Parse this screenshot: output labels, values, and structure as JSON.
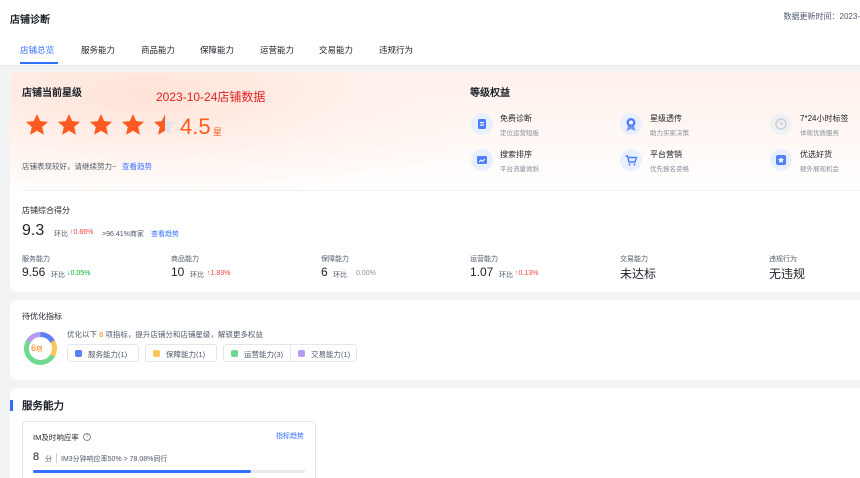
{
  "header": {
    "title": "店铺诊断",
    "update_label": "数据更新时间：2023-"
  },
  "tabs": [
    {
      "label": "店铺总览",
      "active": true
    },
    {
      "label": "服务能力",
      "active": false
    },
    {
      "label": "商品能力",
      "active": false
    },
    {
      "label": "保障能力",
      "active": false
    },
    {
      "label": "运营能力",
      "active": false
    },
    {
      "label": "交易能力",
      "active": false
    },
    {
      "label": "违规行为",
      "active": false
    }
  ],
  "star_level": {
    "title": "店铺当前星级",
    "date_stamp": "2023-10-24店铺数据",
    "rating": 4.5,
    "rating_text": "4.5",
    "unit": "星",
    "hint": "店铺表现较好，请继续努力~",
    "trend_link": "查看趋势"
  },
  "rights": {
    "title": "等级权益",
    "items": [
      {
        "title": "免费诊断",
        "sub": "定位运营短板",
        "icon": "diagnosis-icon"
      },
      {
        "title": "星级透传",
        "sub": "助力买家决策",
        "icon": "medal-icon"
      },
      {
        "title": "7*24小时标签",
        "sub": "体现优质服务",
        "icon": "clock-tag-icon"
      },
      {
        "title": "搜索排序",
        "sub": "平台流量倾斜",
        "icon": "search-rank-icon"
      },
      {
        "title": "平台营销",
        "sub": "优先报名资格",
        "icon": "cart-icon"
      },
      {
        "title": "优选好货",
        "sub": "额外展现机会",
        "icon": "star-badge-icon"
      }
    ]
  },
  "total_score": {
    "title": "店铺综合得分",
    "value": "9.3",
    "ratio_label": "环比",
    "ratio_value": "0.66%",
    "beat_text": ">96.41%商家",
    "trend_link": "查看趋势"
  },
  "metrics": [
    {
      "label": "服务能力",
      "value": "9.56",
      "ratio_label": "环比",
      "ratio": "0.05%",
      "dir": "down"
    },
    {
      "label": "商品能力",
      "value": "10",
      "ratio_label": "环比",
      "ratio": "1.83%",
      "dir": "up"
    },
    {
      "label": "保障能力",
      "value": "6",
      "ratio_label": "环比",
      "ratio": "0.00%",
      "dir": "flat"
    },
    {
      "label": "运营能力",
      "value": "1.07",
      "ratio_label": "环比",
      "ratio": "0.13%",
      "dir": "up"
    },
    {
      "label": "交易能力",
      "value": "未达标",
      "ratio_label": "",
      "ratio": "",
      "dir": ""
    },
    {
      "label": "违规行为",
      "value": "无违规",
      "ratio_label": "",
      "ratio": "",
      "dir": ""
    }
  ],
  "optimize": {
    "title": "待优化指标",
    "desc_pre": "优化以下",
    "desc_num": "6",
    "desc_post": "项指标，提升店铺分和店铺星级，解锁更多权益",
    "count_num": "6",
    "count_unit": "项",
    "chips": [
      {
        "label": "服务能力(1)",
        "color": "#5b7ff7"
      },
      {
        "label": "保障能力(1)",
        "color": "#fbc75a"
      },
      {
        "label": "运营能力(3)",
        "color": "#6fd98f"
      },
      {
        "label": "交易能力(1)",
        "color": "#b49cf0"
      }
    ],
    "donut": [
      1,
      1,
      3,
      1
    ]
  },
  "service": {
    "title": "服务能力",
    "card": {
      "title": "IM及时响应率",
      "link": "指标趋势",
      "value": "8",
      "unit": "分",
      "desc": "IM3分钟响应率50%  > 78.08%同行",
      "progress": 0.8
    }
  },
  "colors": {
    "accent": "#3370ff",
    "star": "#ff5a1f",
    "up": "#f53f3f",
    "down": "#00b42a"
  }
}
